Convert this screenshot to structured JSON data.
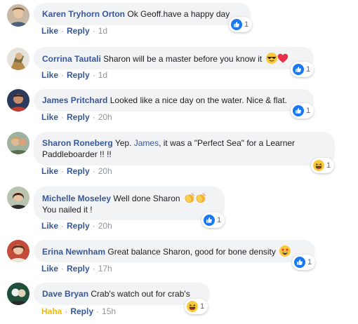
{
  "comments": [
    {
      "author": "Karen Tryhorn Orton",
      "text": "Ok Geoff.have a happy day",
      "like": "Like",
      "reply": "Reply",
      "time": "1d",
      "reaction_icon": "like-icon",
      "reaction_count": "1"
    },
    {
      "author": "Corrina Tautali",
      "text": "Sharon will be a master before you know it",
      "like": "Like",
      "reply": "Reply",
      "time": "1d",
      "reaction_icon": "like-icon",
      "reaction_count": "1"
    },
    {
      "author": "James Pritchard",
      "text": "Looked like a nice day on the water. Nice & flat.",
      "like": "Like",
      "reply": "Reply",
      "time": "20h",
      "reaction_icon": "like-icon",
      "reaction_count": "1"
    },
    {
      "author": "Sharon Roneberg",
      "text_before": "Yep.",
      "mention": "James",
      "text_after": ", it was a \"Perfect Sea\" for a Learner",
      "text_line2": "Paddleboarder !! !!",
      "like": "Like",
      "reply": "Reply",
      "time": "20h",
      "reaction_icon": "haha-icon",
      "reaction_count": "1"
    },
    {
      "author": "Michelle Moseley",
      "text": "Well done Sharon",
      "text_line2": "You nailed it !",
      "like": "Like",
      "reply": "Reply",
      "time": "20h",
      "reaction_icon": "like-icon",
      "reaction_count": "1"
    },
    {
      "author": "Erina Newnham",
      "text": "Great balance Sharon, good for bone density",
      "like": "Like",
      "reply": "Reply",
      "time": "17h",
      "reaction_icon": "like-icon",
      "reaction_count": "1"
    },
    {
      "author": "Dave Bryan",
      "text": "Crab's watch out for crab's",
      "like": "Haha",
      "reply": "Reply",
      "time": "15h",
      "reaction_icon": "haha-icon",
      "reaction_count": "1"
    }
  ],
  "colors": {
    "link": "#385898",
    "bubble": "#f2f3f5",
    "muted": "#90949c",
    "like_blue": "#1877f2",
    "haha_yellow": "#f0ba15"
  }
}
